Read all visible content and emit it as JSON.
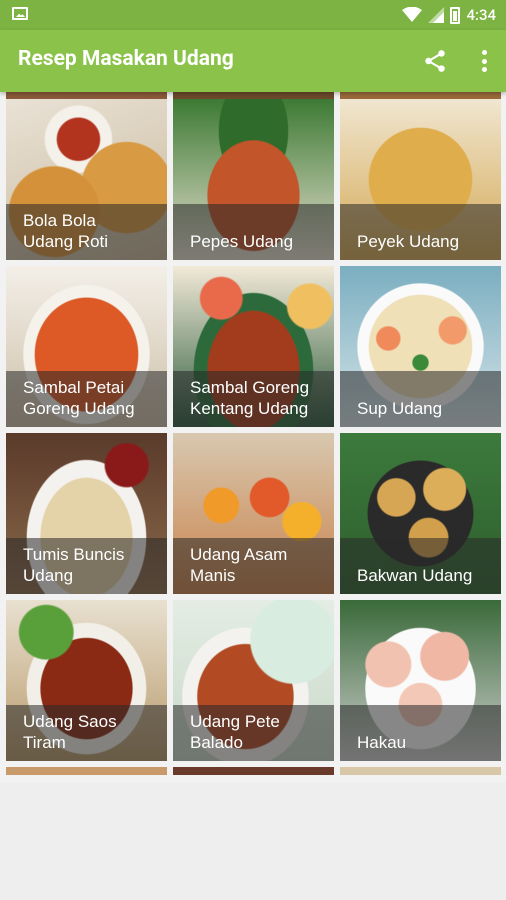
{
  "status_bar": {
    "time": "4:34"
  },
  "app_bar": {
    "title": "Resep Masakan Udang"
  },
  "recipes": [
    {
      "label": "Bola Bola Udang Roti",
      "line1": "Bola Bola",
      "line2": "Udang Roti",
      "bg": "#c98c3a"
    },
    {
      "label": "Pepes Udang",
      "line1": "Pepes Udang",
      "line2": "",
      "bg": "#b5532a"
    },
    {
      "label": "Peyek Udang",
      "line1": "Peyek Udang",
      "line2": "",
      "bg": "#d9a543"
    },
    {
      "label": "Sambal Petai Goreng Udang",
      "line1": "Sambal Petai",
      "line2": "Goreng Udang",
      "bg": "#d3542a"
    },
    {
      "label": "Sambal Goreng Kentang Udang",
      "line1": "Sambal Goreng",
      "line2": "Kentang Udang",
      "bg": "#a8421f"
    },
    {
      "label": "Sup Udang",
      "line1": "Sup Udang",
      "line2": "",
      "bg": "#e8d8b8"
    },
    {
      "label": "Tumis Buncis Udang",
      "line1": "Tumis Buncis",
      "line2": "Udang",
      "bg": "#8a9a5b"
    },
    {
      "label": "Udang Asam Manis",
      "line1": "Udang Asam",
      "line2": "Manis",
      "bg": "#d46a2a"
    },
    {
      "label": "Bakwan Udang",
      "line1": "Bakwan Udang",
      "line2": "",
      "bg": "#c8a24a"
    },
    {
      "label": "Udang Saos Tiram",
      "line1": "Udang Saos",
      "line2": "Tiram",
      "bg": "#9c3a1c"
    },
    {
      "label": "Udang Pete Balado",
      "line1": "Udang Pete",
      "line2": "Balado",
      "bg": "#b6542c"
    },
    {
      "label": "Hakau",
      "line1": "Hakau",
      "line2": "",
      "bg": "#e9b9a6"
    }
  ],
  "colors": {
    "primary": "#8BC34A",
    "primary_dark": "#7CB342"
  }
}
